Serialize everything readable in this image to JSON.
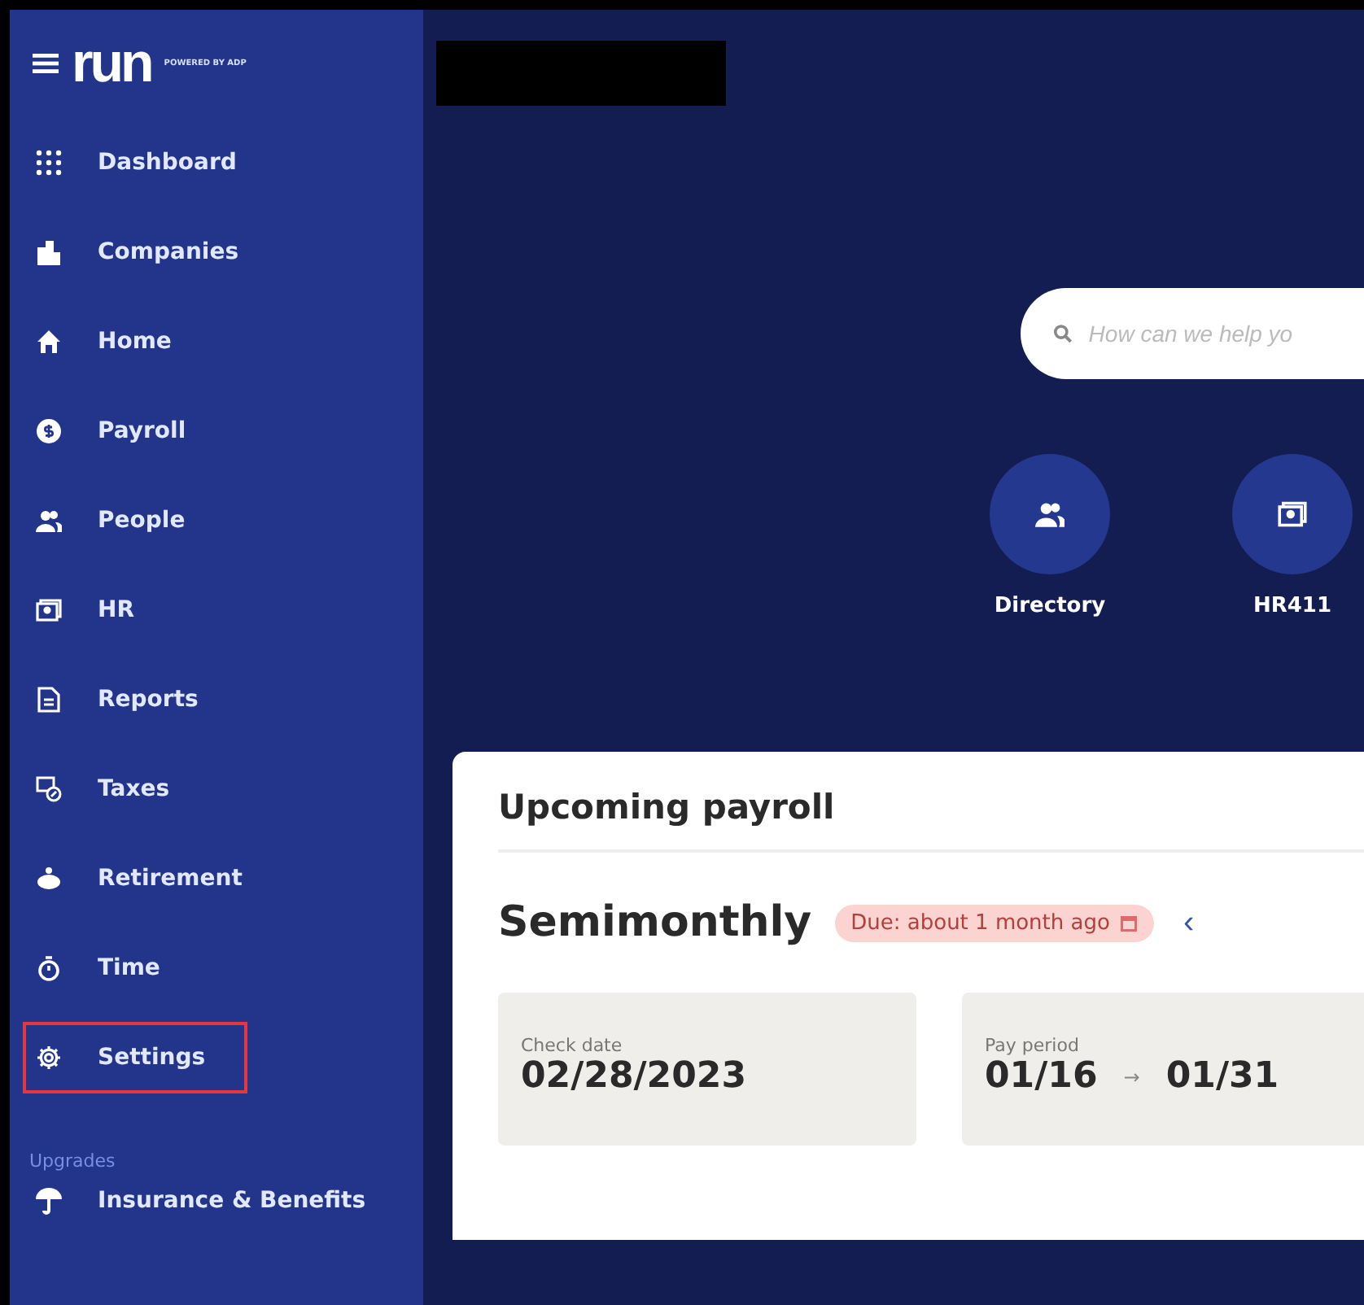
{
  "sidebar": {
    "logo": "run",
    "logo_tagline": "POWERED BY ADP",
    "items": [
      {
        "label": "Dashboard",
        "outlined": false
      },
      {
        "label": "Companies",
        "outlined": false
      },
      {
        "label": "Home",
        "outlined": false
      },
      {
        "label": "Payroll",
        "outlined": false
      },
      {
        "label": "People",
        "outlined": false
      },
      {
        "label": "HR",
        "outlined": false
      },
      {
        "label": "Reports",
        "outlined": false
      },
      {
        "label": "Taxes",
        "outlined": false
      },
      {
        "label": "Retirement",
        "outlined": false
      },
      {
        "label": "Time",
        "outlined": false
      },
      {
        "label": "Settings",
        "outlined": true
      }
    ],
    "section_label": "Upgrades",
    "upgrade_items": [
      {
        "label": "Insurance & Benefits"
      }
    ]
  },
  "main": {
    "search": {
      "placeholder": "How can we help yo"
    },
    "quick_links": [
      {
        "label": "Directory"
      },
      {
        "label": "HR411"
      }
    ],
    "card": {
      "title": "Upcoming payroll",
      "frequency": "Semimonthly",
      "due_badge": "Due: about 1 month ago",
      "prev_arrow": "‹",
      "check_date": {
        "label": "Check date",
        "value": "02/28/2023"
      },
      "pay_period": {
        "label": "Pay period",
        "start": "01/16",
        "arrow": "→",
        "end": "01/31"
      }
    }
  }
}
